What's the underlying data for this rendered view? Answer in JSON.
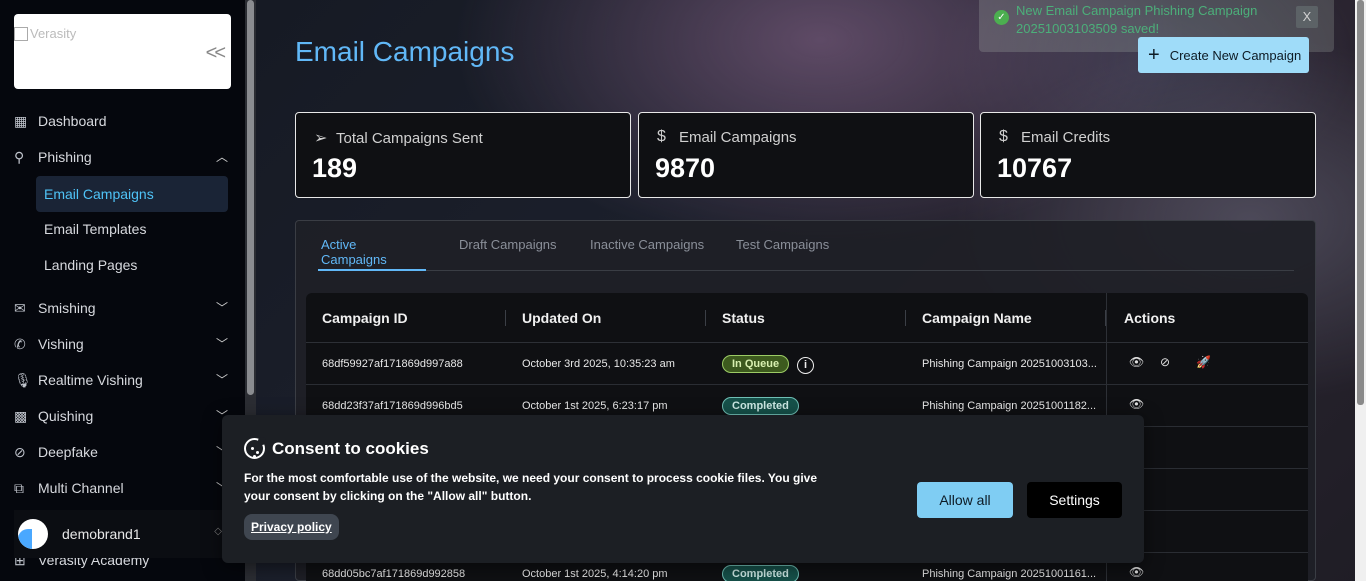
{
  "sidebar": {
    "logo_alt": "Verasity",
    "items": [
      {
        "label": "Dashboard",
        "icon": "dashboard-icon"
      },
      {
        "label": "Phishing",
        "icon": "hook-icon"
      },
      {
        "label": "Smishing",
        "icon": "sms-icon"
      },
      {
        "label": "Vishing",
        "icon": "phone-icon"
      },
      {
        "label": "Realtime Vishing",
        "icon": "microphone-icon"
      },
      {
        "label": "Quishing",
        "icon": "qr-code-icon"
      },
      {
        "label": "Deepfake",
        "icon": "deepfake-icon"
      },
      {
        "label": "Multi Channel",
        "icon": "network-icon"
      },
      {
        "label": "Verasity Academy",
        "icon": "academy-icon"
      }
    ],
    "phishing_sub": [
      "Email Campaigns",
      "Email Templates",
      "Landing Pages"
    ],
    "brand": "demobrand1"
  },
  "header": {
    "title": "Email Campaigns",
    "create_button": "Create New Campaign"
  },
  "toast": {
    "message": "New Email Campaign Phishing Campaign 20251003103509 saved!",
    "close": "X"
  },
  "stats": [
    {
      "label": "Total Campaigns Sent",
      "value": "189",
      "icon": "send-icon"
    },
    {
      "label": "Email Campaigns",
      "value": "9870",
      "icon": "dollar-icon"
    },
    {
      "label": "Email Credits",
      "value": "10767",
      "icon": "dollar-icon"
    }
  ],
  "tabs": [
    "Active Campaigns",
    "Draft Campaigns",
    "Inactive Campaigns",
    "Test Campaigns"
  ],
  "table": {
    "columns": [
      "Campaign ID",
      "Updated On",
      "Status",
      "Campaign Name",
      "Actions"
    ],
    "rows": [
      {
        "id": "68df59927af171869d997a88",
        "updated": "October 3rd 2025, 10:35:23 am",
        "status": "In Queue",
        "name": "Phishing Campaign 20251003103..."
      },
      {
        "id": "68dd23f37af171869d996bd5",
        "updated": "October 1st 2025, 6:23:17 pm",
        "status": "Completed",
        "name": "Phishing Campaign 20251001182..."
      },
      {
        "id": "68dd05bc7af171869d992858",
        "updated": "October 1st 2025, 4:14:20 pm",
        "status": "Completed",
        "name": "Phishing Campaign 20251001161..."
      }
    ]
  },
  "cookie": {
    "title": "Consent to cookies",
    "text": "For the most comfortable use of the website, we need your consent to process cookie files. You give your consent by clicking on the \"Allow all\" button.",
    "privacy": "Privacy policy",
    "allow": "Allow all",
    "settings": "Settings"
  },
  "colors": {
    "accent": "#61b8f7",
    "button": "#9fdcf9",
    "queue": "#3d5a1e",
    "completed": "#16514a"
  }
}
